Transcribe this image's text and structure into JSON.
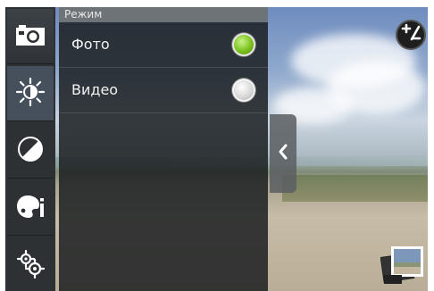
{
  "menu": {
    "header": "Режим",
    "options": [
      {
        "label": "Фото",
        "selected": true
      },
      {
        "label": "Видео",
        "selected": false
      }
    ]
  },
  "sidebar": {
    "items": [
      {
        "icon": "camera-icon"
      },
      {
        "icon": "brightness-icon"
      },
      {
        "icon": "contrast-icon"
      },
      {
        "icon": "effects-icon"
      },
      {
        "icon": "settings-gears-icon"
      }
    ]
  },
  "controls": {
    "exposure": "exposure-icon",
    "collapse": "chevron-left-icon",
    "gallery": "gallery-thumbnail"
  },
  "colors": {
    "selected_radio": "#7cc21d",
    "sidebar_bg": "#2e3134",
    "menu_header_bg": "#6e7378"
  }
}
